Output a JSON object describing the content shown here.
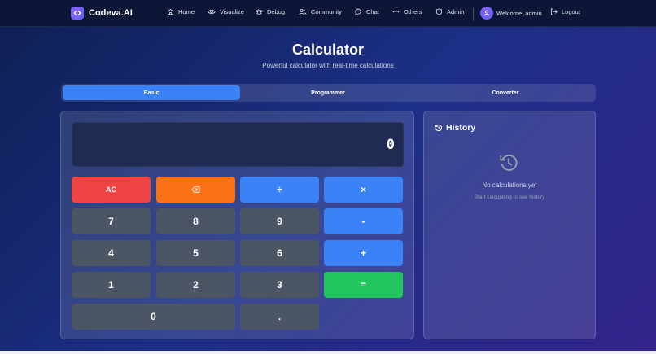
{
  "nav": {
    "brand": "Codeva.AI",
    "items": [
      {
        "label": "Home",
        "icon": "home-icon"
      },
      {
        "label": "Visualize",
        "icon": "eye-icon"
      },
      {
        "label": "Debug",
        "icon": "bug-icon"
      },
      {
        "label": "Community",
        "icon": "users-icon"
      },
      {
        "label": "Chat",
        "icon": "chat-icon"
      },
      {
        "label": "Others",
        "icon": "dots-icon"
      },
      {
        "label": "Admin",
        "icon": "shield-icon"
      }
    ],
    "welcome": "Welcome, admin",
    "logout": "Logout"
  },
  "page": {
    "title": "Calculator",
    "subtitle": "Powerful calculator with real-time calculations"
  },
  "tabs": [
    {
      "label": "Basic",
      "active": true
    },
    {
      "label": "Programmer",
      "active": false
    },
    {
      "label": "Converter",
      "active": false
    }
  ],
  "calculator": {
    "display": "0",
    "keys": {
      "ac": "AC",
      "divide": "÷",
      "multiply": "×",
      "subtract": "-",
      "add": "+",
      "equals": "=",
      "decimal": ".",
      "n0": "0",
      "n1": "1",
      "n2": "2",
      "n3": "3",
      "n4": "4",
      "n5": "5",
      "n6": "6",
      "n7": "7",
      "n8": "8",
      "n9": "9"
    }
  },
  "history": {
    "title": "History",
    "empty": "No calculations yet",
    "hint": "Start calculating to see history"
  },
  "colors": {
    "primary": "#3b82f6",
    "clear": "#ef4444",
    "backspace": "#f97316",
    "equals": "#22c55e",
    "number_key": "#4b5563"
  }
}
